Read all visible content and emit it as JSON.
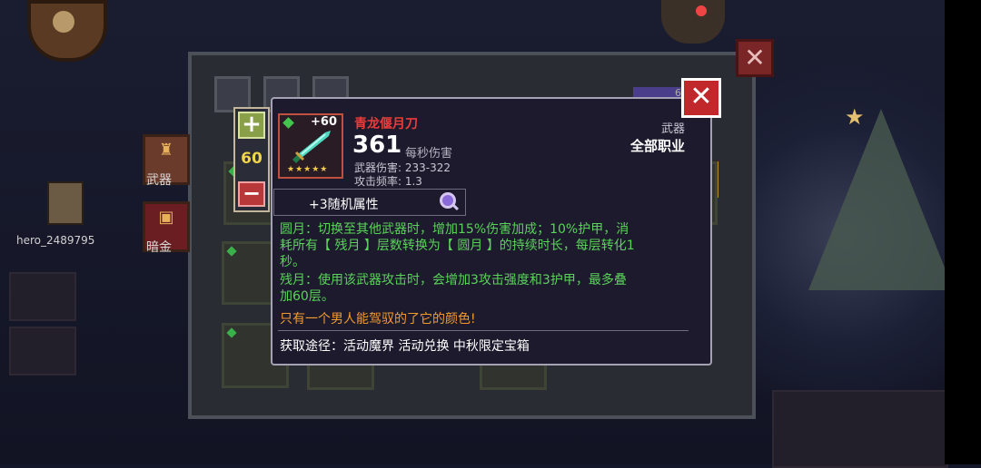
{
  "player": {
    "name": "hero_2489795"
  },
  "sidebar": {
    "weapon_label": "武器",
    "dark_gold_label": "暗金"
  },
  "inventory": {
    "gold_partial": "62"
  },
  "stepper": {
    "plus": "+",
    "value": "60",
    "minus": "−"
  },
  "item": {
    "level": "+60",
    "stars": "★★★★★",
    "name": "青龙偃月刀",
    "dps": "361",
    "dps_label": "每秒伤害",
    "weapon_damage": "武器伤害: 233-322",
    "attack_rate": "攻击频率: 1.3",
    "type": "武器",
    "class": "全部职业",
    "random_attr": "+3随机属性",
    "desc_full_moon_1": "圆月：切换至其他武器时，增加15%伤害加成；10%护甲，消",
    "desc_full_moon_2": "耗所有【 残月 】层数转换为【 圆月 】的持续时长，每层转化1",
    "desc_full_moon_3": "秒。",
    "desc_waning_1": "残月：使用该武器攻击时，会增加3攻击强度和3护甲，最多叠",
    "desc_waning_2": "加60层。",
    "flavor": "只有一个男人能驾驭的了它的颜色!",
    "source": "获取途径：活动魔界 活动兑换 中秋限定宝箱"
  },
  "colors": {
    "name_red": "#ec3b3b",
    "desc_green": "#5ad35a",
    "flavor_orange": "#f39a2e",
    "value_yellow": "#f0d44a"
  }
}
